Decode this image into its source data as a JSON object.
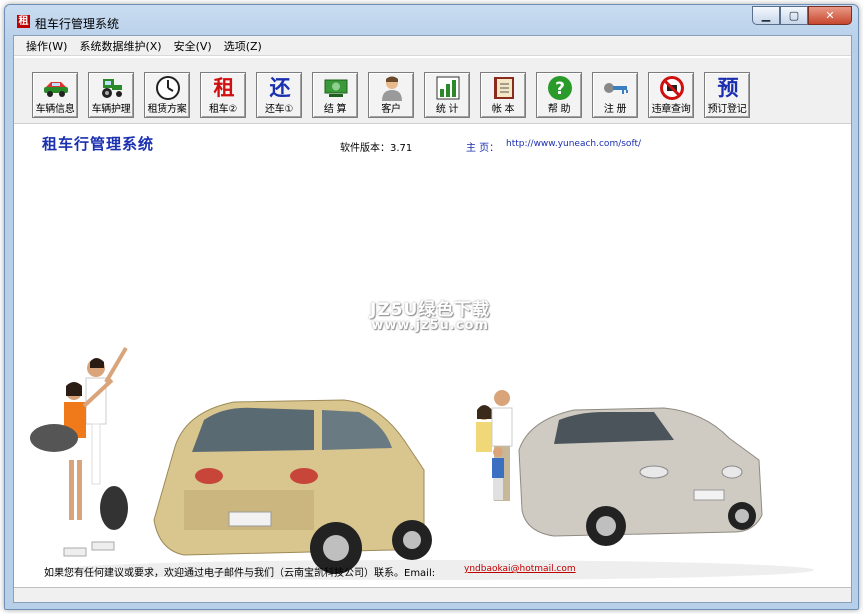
{
  "window": {
    "title": "租车行管理系统",
    "app_icon_glyph": "租",
    "controls": [
      "minimize",
      "maximize",
      "close"
    ]
  },
  "menu": [
    {
      "label": "操作(W)"
    },
    {
      "label": "系统数据维护(X)"
    },
    {
      "label": "安全(V)"
    },
    {
      "label": "选项(Z)"
    }
  ],
  "toolbar": [
    {
      "label": "车辆信息",
      "icon": "car-icon"
    },
    {
      "label": "车辆护理",
      "icon": "tractor-icon"
    },
    {
      "label": "租赁方案",
      "icon": "clock-icon"
    },
    {
      "label": "租车②",
      "icon": "rent-char-icon",
      "glyph": "租"
    },
    {
      "label": "还车①",
      "icon": "return-char-icon",
      "glyph": "还"
    },
    {
      "label": "结 算",
      "icon": "money-icon"
    },
    {
      "label": "客户",
      "icon": "customer-icon"
    },
    {
      "label": "统 计",
      "icon": "bar-chart-icon"
    },
    {
      "label": "帐 本",
      "icon": "book-icon"
    },
    {
      "label": "帮 助",
      "icon": "help-icon"
    },
    {
      "label": "注 册",
      "icon": "key-icon"
    },
    {
      "label": "违章查询",
      "icon": "no-entry-icon"
    },
    {
      "label": "预订登记",
      "icon": "reserve-char-icon",
      "glyph": "预"
    }
  ],
  "header": {
    "system_title": "租车行管理系统",
    "version": "软件版本：3.71",
    "homepage_label": "主 页：",
    "homepage_url": "http://www.yuneach.com/soft/"
  },
  "watermark": {
    "line1": "JZ5U绿色下载",
    "line2": "www.jz5u.com"
  },
  "footer": {
    "message": "如果您有任何建议或要求，欢迎通过电子邮件与我们（云南宝凯科技公司）联系。Email:",
    "email": "yndbaokai@hotmail.com"
  },
  "colors": {
    "title_blue": "#1a2fb0",
    "email_red": "#c00000",
    "toolbar_bg": "#f0f0f0"
  }
}
